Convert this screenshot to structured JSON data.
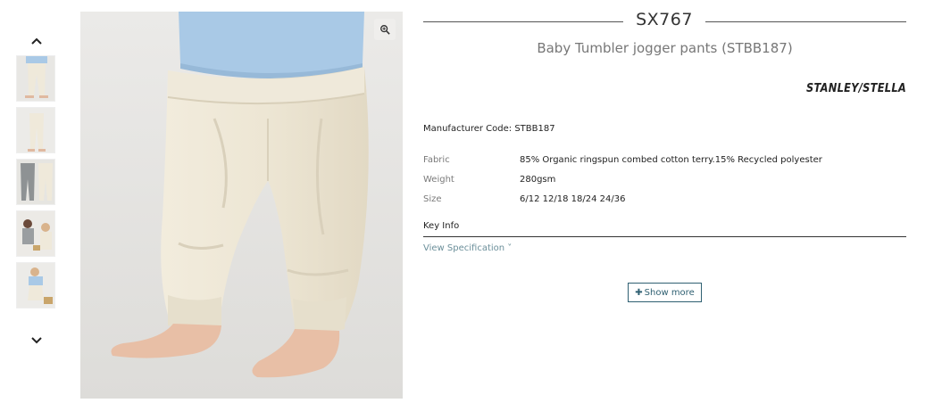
{
  "product": {
    "sku": "SX767",
    "name": "Baby Tumbler jogger pants (STBB187)",
    "brand_logo_text": "STANLEY/STELLA",
    "manufacturer_code": "Manufacturer Code: STBB187"
  },
  "specs": [
    {
      "label": "Fabric",
      "value": "85% Organic ringspun combed cotton terry.15% Recycled polyester"
    },
    {
      "label": "Weight",
      "value": "280gsm"
    },
    {
      "label": "Size",
      "value": "6/12 12/18 18/24 24/36"
    }
  ],
  "key_info": {
    "heading": "Key Info",
    "view_spec_label": "View Specification ˅"
  },
  "buttons": {
    "show_more_icon": "✚",
    "show_more_label": "Show more"
  },
  "gallery": {
    "thumbnail_count": 5,
    "icons": [
      "chevron-up-icon",
      "chevron-down-icon",
      "zoom-icon"
    ]
  },
  "colors": {
    "accent": "#2f6072",
    "link": "#6b8f9a",
    "pants": "#efe9da",
    "sweater": "#a9c9e6",
    "image_bg": "#e9e8e6"
  }
}
